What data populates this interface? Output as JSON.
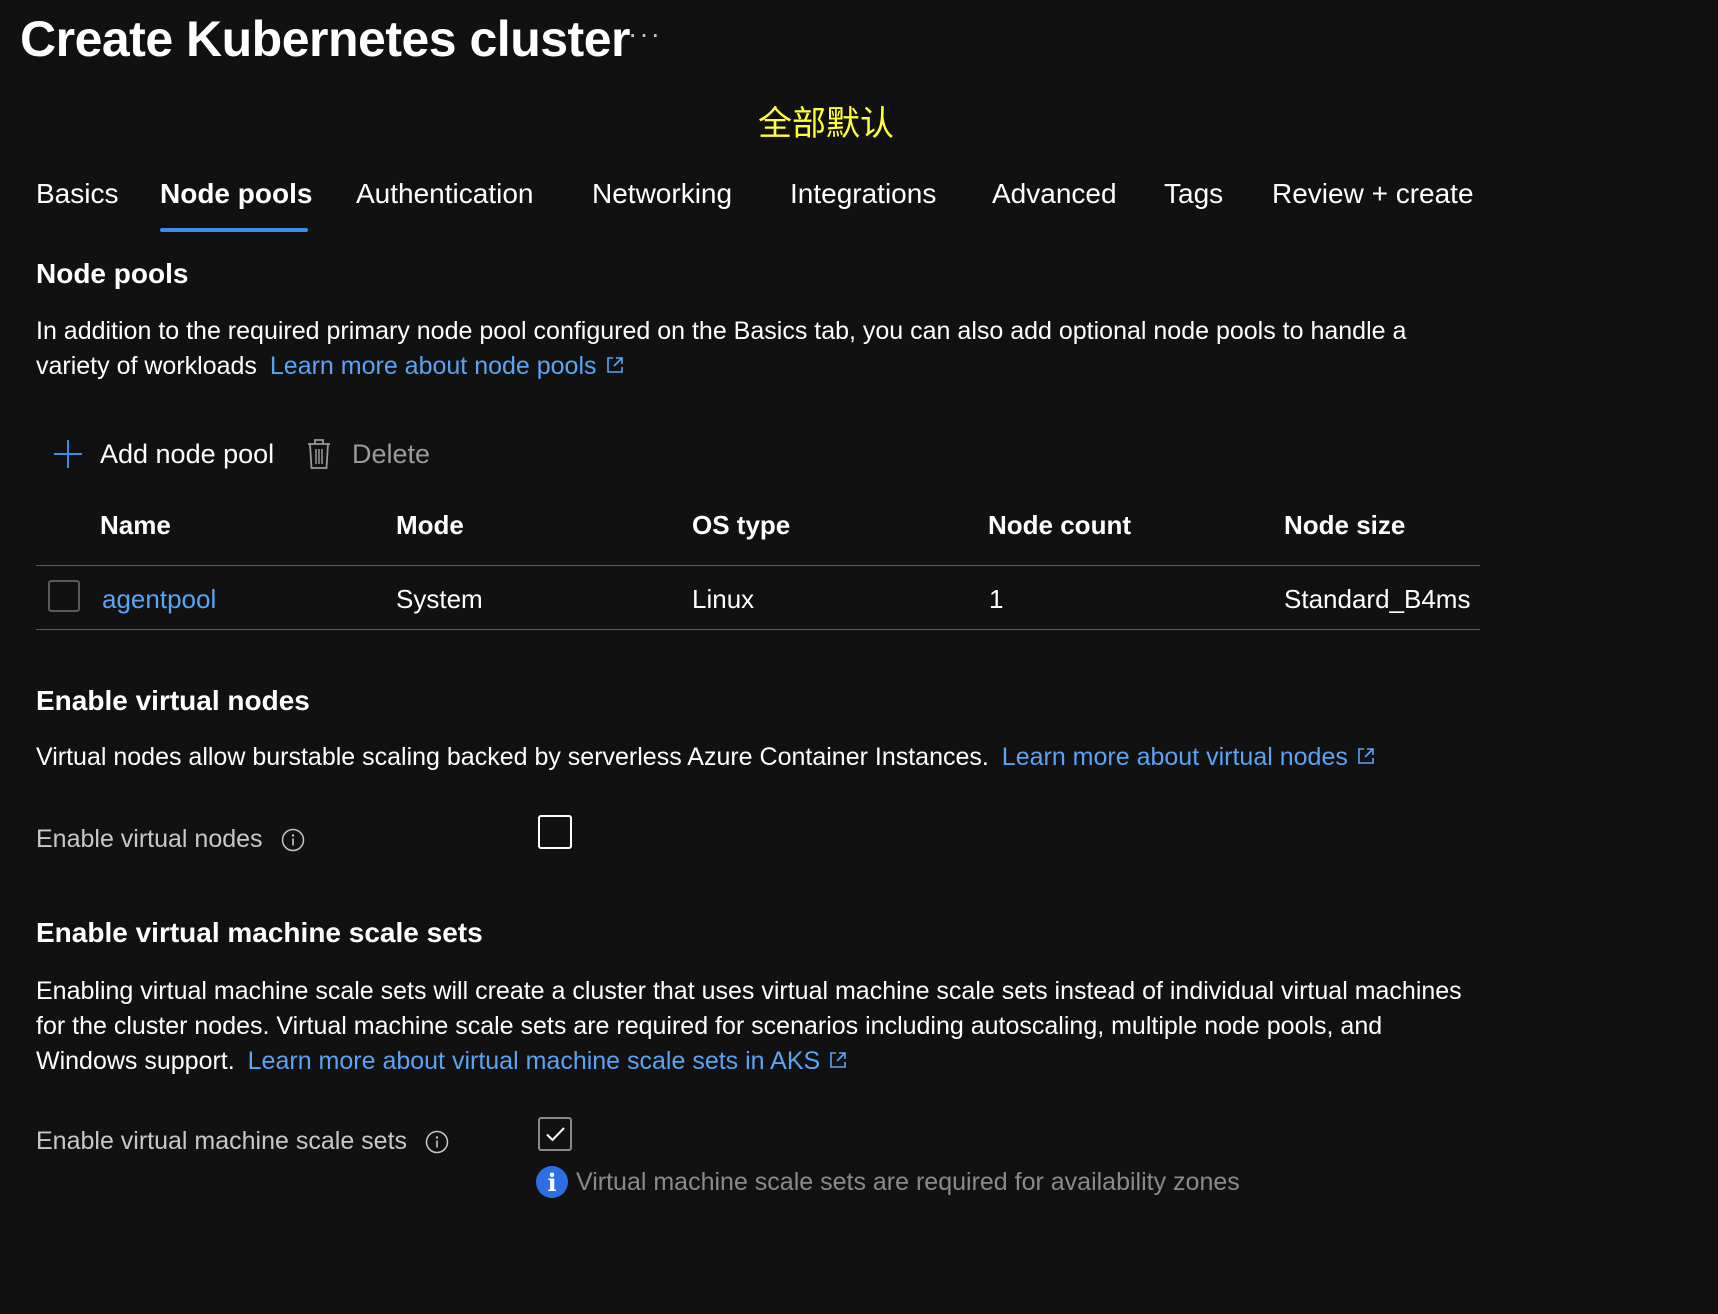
{
  "page": {
    "title": "Create Kubernetes cluster",
    "more_label": "···",
    "annotation": "全部默认"
  },
  "tabs": [
    {
      "label": "Basics",
      "active": false
    },
    {
      "label": "Node pools",
      "active": true
    },
    {
      "label": "Authentication",
      "active": false
    },
    {
      "label": "Networking",
      "active": false
    },
    {
      "label": "Integrations",
      "active": false
    },
    {
      "label": "Advanced",
      "active": false
    },
    {
      "label": "Tags",
      "active": false
    },
    {
      "label": "Review + create",
      "active": false
    }
  ],
  "node_pools": {
    "heading": "Node pools",
    "description": "In addition to the required primary node pool configured on the Basics tab, you can also add optional node pools to handle a variety of workloads",
    "learn_more": "Learn more about node pools",
    "toolbar": {
      "add_label": "Add node pool",
      "delete_label": "Delete"
    },
    "table": {
      "columns": [
        "Name",
        "Mode",
        "OS type",
        "Node count",
        "Node size"
      ],
      "rows": [
        {
          "name": "agentpool",
          "mode": "System",
          "os_type": "Linux",
          "node_count": "1",
          "node_size": "Standard_B4ms",
          "selected": false
        }
      ]
    }
  },
  "virtual_nodes": {
    "heading": "Enable virtual nodes",
    "description": "Virtual nodes allow burstable scaling backed by serverless Azure Container Instances.",
    "learn_more": "Learn more about virtual nodes",
    "field_label": "Enable virtual nodes",
    "checked": false
  },
  "vmss": {
    "heading": "Enable virtual machine scale sets",
    "description": "Enabling virtual machine scale sets will create a cluster that uses virtual machine scale sets instead of individual virtual machines for the cluster nodes. Virtual machine scale sets are required for scenarios including autoscaling, multiple node pools, and Windows support.",
    "learn_more": "Learn more about virtual machine scale sets in AKS",
    "field_label": "Enable virtual machine scale sets",
    "checked": true,
    "hint": "Virtual machine scale sets are required for availability zones"
  },
  "colors": {
    "background": "#111111",
    "link": "#5aa3f5",
    "accent": "#3a8eea",
    "annotation": "#ffff3a",
    "info": "#2b6fe0"
  },
  "icons": {
    "add": "plus-icon",
    "delete": "trash-icon",
    "external": "external-link-icon",
    "info": "info-circle-icon",
    "hint": "info-filled-icon"
  }
}
